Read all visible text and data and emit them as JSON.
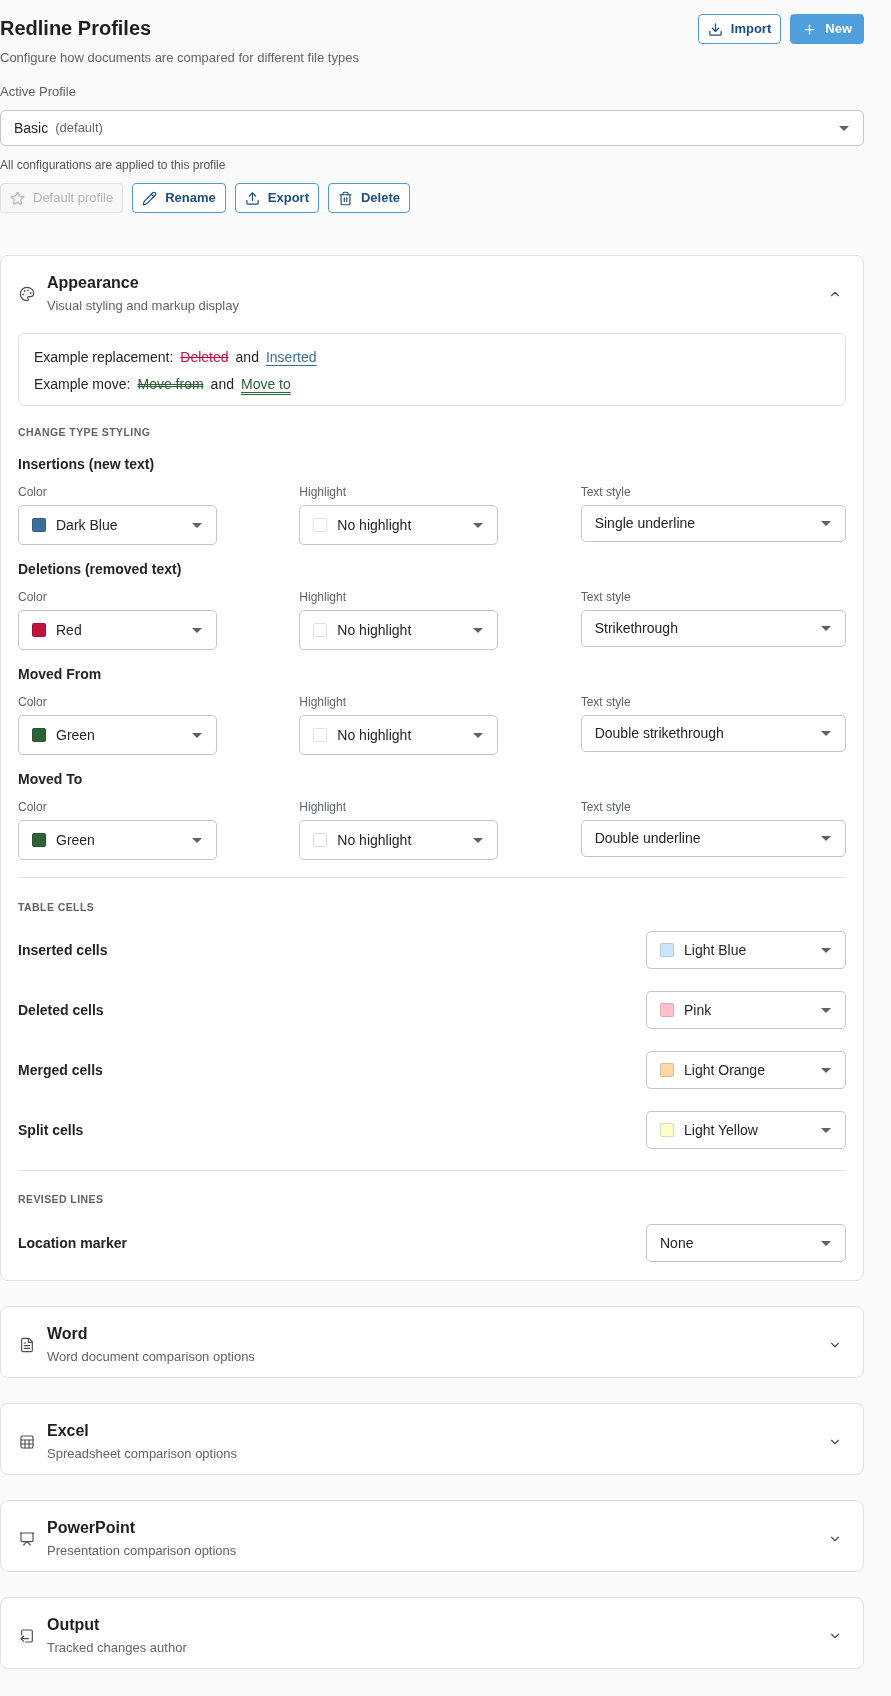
{
  "header": {
    "title": "Redline Profiles",
    "subtitle": "Configure how documents are compared for different file types",
    "buttons": [
      {
        "label": "Import",
        "kind": "outline"
      },
      {
        "label": "New",
        "kind": "primary"
      }
    ]
  },
  "active_profile": {
    "label": "Active Profile",
    "value": "Basic",
    "note": "(default)",
    "helper": "All configurations are applied to this profile"
  },
  "profile_actions": [
    {
      "label": "Default profile",
      "disabled": true
    },
    {
      "label": "Rename",
      "disabled": false
    },
    {
      "label": "Export",
      "disabled": false
    },
    {
      "label": "Delete",
      "disabled": false
    }
  ],
  "sections": [
    {
      "title": "Appearance",
      "subtitle": "Visual styling and markup display",
      "expanded": true,
      "example": [
        {
          "label": "Example replacement:",
          "before": {
            "text": "Deleted",
            "color": "#c0123c",
            "kind": "strikethrough"
          },
          "joiner": "and",
          "after": {
            "text": "Inserted",
            "color": "#3a6f9a",
            "kind": "underline"
          }
        },
        {
          "label": "Example move:",
          "before": {
            "text": "Move from",
            "color": "#2d6136",
            "kind": "double-strikethrough"
          },
          "joiner": "and",
          "after": {
            "text": "Move to",
            "color": "#2d6136",
            "kind": "double-underline"
          }
        }
      ],
      "change_type_styling": {
        "heading": "CHANGE TYPE STYLING",
        "groups": [
          {
            "title": "Insertions (new text)",
            "fields": [
              {
                "label": "Color",
                "value": "Dark Blue",
                "color": "#3a6f9a"
              },
              {
                "label": "Highlight",
                "value": "No highlight",
                "color": "#ffffff"
              },
              {
                "label": "Text style",
                "value": "Single underline"
              }
            ]
          },
          {
            "title": "Deletions (removed text)",
            "fields": [
              {
                "label": "Color",
                "value": "Red",
                "color": "#c0123c"
              },
              {
                "label": "Highlight",
                "value": "No highlight",
                "color": "#ffffff"
              },
              {
                "label": "Text style",
                "value": "Strikethrough"
              }
            ]
          },
          {
            "title": "Moved From",
            "fields": [
              {
                "label": "Color",
                "value": "Green",
                "color": "#2d6136"
              },
              {
                "label": "Highlight",
                "value": "No highlight",
                "color": "#ffffff"
              },
              {
                "label": "Text style",
                "value": "Double strikethrough"
              }
            ]
          },
          {
            "title": "Moved To",
            "fields": [
              {
                "label": "Color",
                "value": "Green",
                "color": "#2d6136"
              },
              {
                "label": "Highlight",
                "value": "No highlight",
                "color": "#ffffff"
              },
              {
                "label": "Text style",
                "value": "Double underline"
              }
            ]
          }
        ]
      },
      "table_cells": {
        "heading": "TABLE CELLS",
        "rows": [
          {
            "label": "Inserted cells",
            "value": "Light Blue",
            "color": "#cce4fa"
          },
          {
            "label": "Deleted cells",
            "value": "Pink",
            "color": "#ffc0cb"
          },
          {
            "label": "Merged cells",
            "value": "Light Orange",
            "color": "#ffd6a5"
          },
          {
            "label": "Split cells",
            "value": "Light Yellow",
            "color": "#fffccc"
          }
        ]
      },
      "revised_lines": {
        "heading": "REVISED LINES",
        "rows": [
          {
            "label": "Location marker",
            "value": "None"
          }
        ]
      }
    },
    {
      "title": "Word",
      "subtitle": "Word document comparison options",
      "expanded": false
    },
    {
      "title": "Excel",
      "subtitle": "Spreadsheet comparison options",
      "expanded": false
    },
    {
      "title": "PowerPoint",
      "subtitle": "Presentation comparison options",
      "expanded": false
    },
    {
      "title": "Output",
      "subtitle": "Tracked changes author",
      "expanded": false
    }
  ]
}
